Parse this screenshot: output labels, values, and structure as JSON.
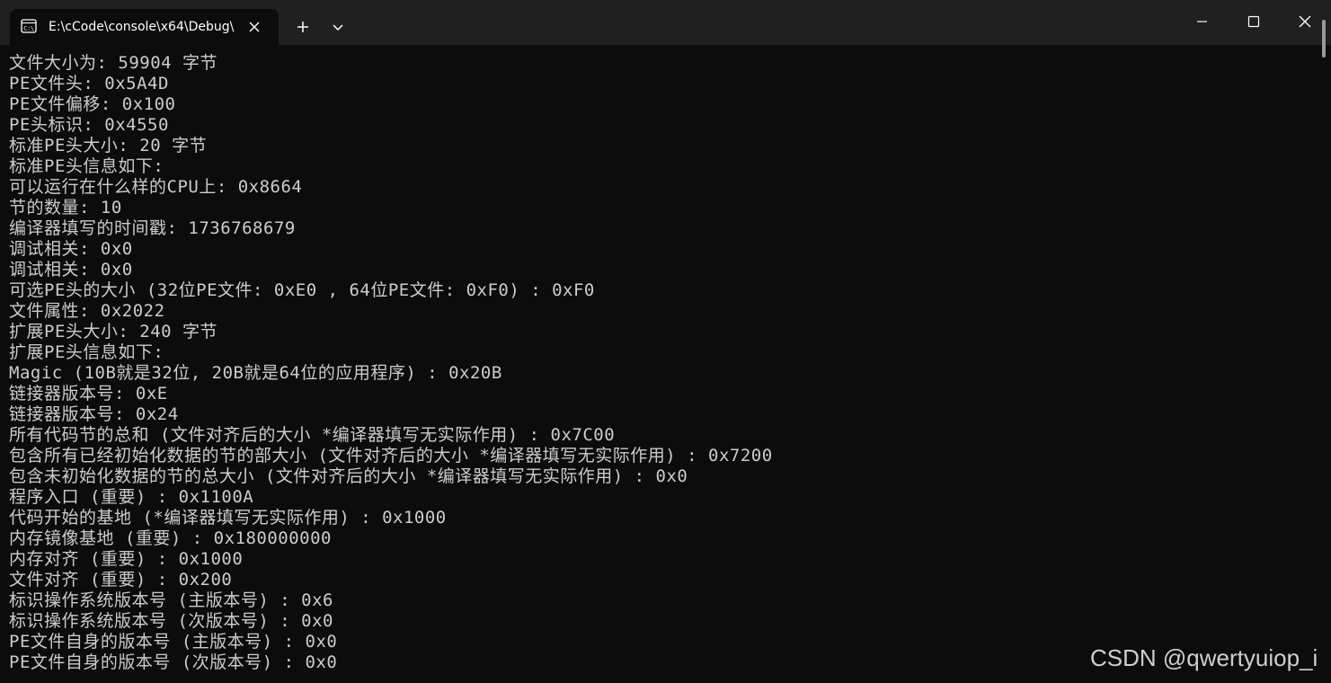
{
  "window": {
    "tab_title": "E:\\cCode\\console\\x64\\Debug\\",
    "tab_icon": "terminal-icon",
    "new_tab_icon": "plus-icon",
    "dropdown_icon": "chevron-down-icon",
    "controls": {
      "minimize_icon": "minimize-icon",
      "maximize_icon": "maximize-icon",
      "close_icon": "close-icon"
    }
  },
  "console": {
    "lines": [
      "文件大小为: 59904 字节",
      "PE文件头: 0x5A4D",
      "PE文件偏移: 0x100",
      "PE头标识: 0x4550",
      "标准PE头大小: 20 字节",
      "标准PE头信息如下:",
      "可以运行在什么样的CPU上: 0x8664",
      "节的数量: 10",
      "编译器填写的时间戳: 1736768679",
      "调试相关: 0x0",
      "调试相关: 0x0",
      "可选PE头的大小 (32位PE文件: 0xE0 , 64位PE文件: 0xF0) : 0xF0",
      "文件属性: 0x2022",
      "扩展PE头大小: 240 字节",
      "扩展PE头信息如下:",
      "Magic (10B就是32位, 20B就是64位的应用程序) : 0x20B",
      "链接器版本号: 0xE",
      "链接器版本号: 0x24",
      "所有代码节的总和 (文件对齐后的大小 *编译器填写无实际作用) : 0x7C00",
      "包含所有已经初始化数据的节的部大小 (文件对齐后的大小 *编译器填写无实际作用) : 0x7200",
      "包含未初始化数据的节的总大小 (文件对齐后的大小 *编译器填写无实际作用) : 0x0",
      "程序入口 (重要) : 0x1100A",
      "代码开始的基地 (*编译器填写无实际作用) : 0x1000",
      "内存镜像基地 (重要) : 0x180000000",
      "内存对齐 (重要) : 0x1000",
      "文件对齐 (重要) : 0x200",
      "标识操作系统版本号 (主版本号) : 0x6",
      "标识操作系统版本号 (次版本号) : 0x0",
      "PE文件自身的版本号 (主版本号) : 0x0",
      "PE文件自身的版本号 (次版本号) : 0x0"
    ]
  },
  "watermark": "CSDN @qwertyuiop_i",
  "colors": {
    "background": "#0c0c0c",
    "titlebar": "#202020",
    "text": "#cccccc"
  }
}
